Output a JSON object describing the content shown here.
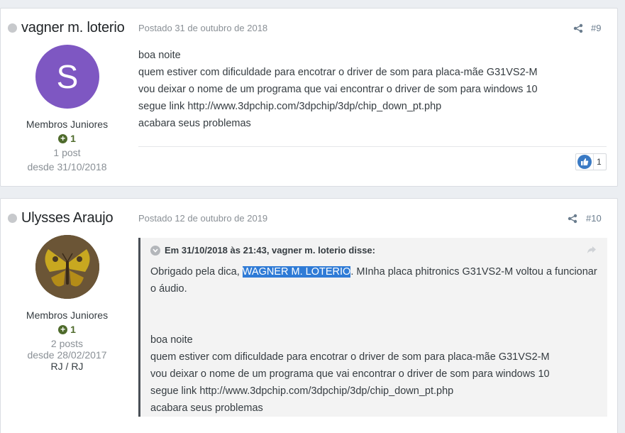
{
  "posts": [
    {
      "author": "vagner m. loterio",
      "avatar_letter": "S",
      "group": "Membros Juniores",
      "reputation": "1",
      "post_count": "1 post",
      "joined": "desde 31/10/2018",
      "date": "Postado 31 de outubro de 2018",
      "number": "#9",
      "lines": [
        "boa noite",
        "quem estiver com dificuldade para encotrar o driver de som para placa-mãe G31VS2-M",
        "vou deixar o nome de um programa que vai encontrar o driver de som para windows 10",
        "segue link http://www.3dpchip.com/3dpchip/3dp/chip_down_pt.php",
        "acabara seus problemas"
      ],
      "likes": "1"
    },
    {
      "author": "Ulysses Araujo",
      "group": "Membros Juniores",
      "reputation": "1",
      "post_count": "2 posts",
      "joined": "desde 28/02/2017",
      "location": "RJ / RJ",
      "date": "Postado 12 de outubro de 2019",
      "number": "#10",
      "quote_header": "Em 31/10/2018 às 21:43, vagner m. loterio disse:",
      "quote_reply_before": "Obrigado pela dica, ",
      "quote_reply_highlight": "WAGNER M. LOTERIO",
      "quote_reply_after": ". MInha placa phitronics G31VS2-M voltou a funcionar o áudio.",
      "quote_lines": [
        "boa noite",
        "quem estiver com dificuldade para encotrar o driver de som para placa-mãe G31VS2-M",
        "vou deixar o nome de um programa que vai encontrar o driver de som para windows 10",
        "segue link http://www.3dpchip.com/3dpchip/3dp/chip_down_pt.php",
        "acabara seus problemas"
      ]
    }
  ],
  "colors": {
    "avatar_purple": "#7e57c2",
    "like_blue": "#3a7ac4",
    "highlight": "#2f7bd6"
  },
  "icons": [
    "status-dot-icon",
    "plus-icon",
    "share-icon",
    "like-icon",
    "chevron-down-icon",
    "reply-arrow-icon"
  ]
}
